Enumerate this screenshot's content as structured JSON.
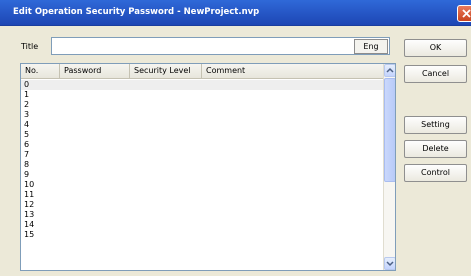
{
  "window": {
    "title": "Edit Operation Security Password - NewProject.nvp"
  },
  "form": {
    "title_label": "Title",
    "title_value": "",
    "eng_button": "Eng"
  },
  "list": {
    "columns": [
      "No.",
      "Password",
      "Security Level",
      "Comment"
    ],
    "rows": [
      "0",
      "1",
      "2",
      "3",
      "4",
      "5",
      "6",
      "7",
      "8",
      "9",
      "10",
      "11",
      "12",
      "13",
      "14",
      "15"
    ],
    "selected_row": "0"
  },
  "buttons": {
    "ok": "OK",
    "cancel": "Cancel",
    "setting": "Setting",
    "delete": "Delete",
    "control": "Control"
  },
  "colors": {
    "titlebar": "#2759c8",
    "dialog_bg": "#ece9d8",
    "close": "#c9441f"
  },
  "icons": {
    "close": "close-icon",
    "scroll_up": "chevron-up-icon",
    "scroll_down": "chevron-down-icon"
  }
}
